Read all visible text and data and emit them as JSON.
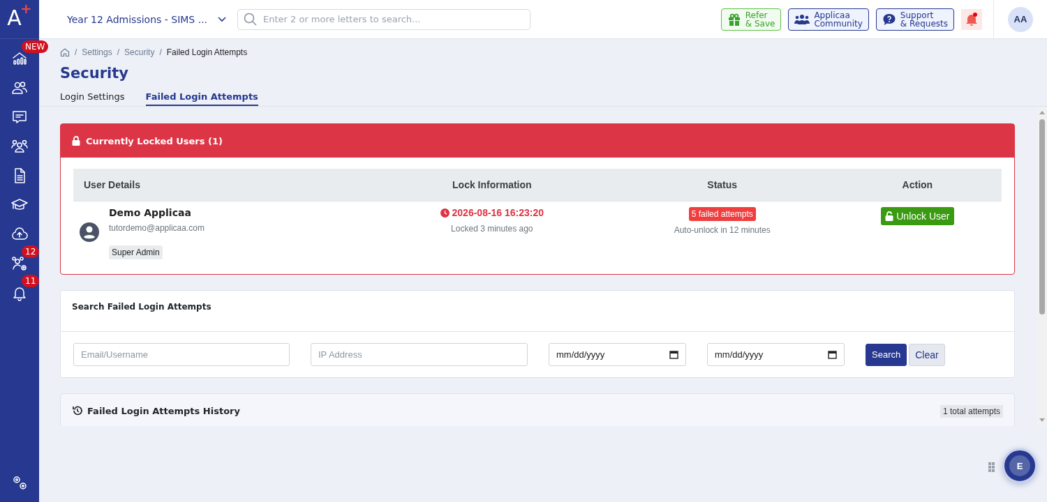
{
  "logo": {
    "letter": "A",
    "mark": "+"
  },
  "sidebar": {
    "items": [
      {
        "kind": "chart",
        "badge": "NEW"
      },
      {
        "kind": "people"
      },
      {
        "kind": "message"
      },
      {
        "kind": "group"
      },
      {
        "kind": "document"
      },
      {
        "kind": "cap"
      },
      {
        "kind": "cloud"
      },
      {
        "kind": "group-gear",
        "badge": "12"
      },
      {
        "kind": "bell",
        "badge": "11"
      }
    ],
    "footer": {
      "kind": "gears"
    }
  },
  "topbar": {
    "workspace": "Year 12 Admissions - SIMS ...",
    "search": {
      "placeholder": "Enter 2 or more letters to search..."
    },
    "buttons": [
      {
        "kind": "gift",
        "lines": [
          "Refer",
          "& Save"
        ]
      },
      {
        "kind": "people",
        "lines": [
          "Applicaa",
          "Community"
        ]
      },
      {
        "kind": "question",
        "lines": [
          "Support",
          "& Requests"
        ]
      }
    ],
    "avatar": "AA"
  },
  "breadcrumb": {
    "separator": "/",
    "items": [
      "Settings",
      "Security",
      "Failed Login Attempts"
    ]
  },
  "title": "Security",
  "tabs": [
    {
      "label": "Login Settings",
      "selected": false
    },
    {
      "label": "Failed Login Attempts",
      "selected": true
    }
  ],
  "locked": {
    "title": "Currently Locked Users (1)",
    "columns": [
      "User Details",
      "Lock Information",
      "Status",
      "Action"
    ],
    "rows": [
      {
        "name": "Demo Applicaa",
        "email": "tutordemo@applicaa.com",
        "role": "Super Admin",
        "locked_at": "2026-08-16 16:23:20",
        "locked_ago": "Locked 3 minutes ago",
        "status": "5 failed attempts",
        "auto_unlock": "Auto-unlock in 12 minutes",
        "action": "Unlock User"
      }
    ]
  },
  "search_panel": {
    "title": "Search Failed Login Attempts",
    "fields": [
      {
        "kind": "text",
        "placeholder": "Email/Username"
      },
      {
        "kind": "text",
        "placeholder": "IP Address"
      },
      {
        "kind": "date",
        "value": "mm/dd/yyyy"
      },
      {
        "kind": "date",
        "value": "mm/dd/yyyy"
      }
    ],
    "buttons": [
      {
        "kind": "primary",
        "label": "Search"
      },
      {
        "kind": "secondary",
        "label": "Clear"
      }
    ]
  },
  "history": {
    "title": "Failed Login Attempts History",
    "count": "1 total attempts"
  },
  "chat": {
    "label": "E"
  }
}
